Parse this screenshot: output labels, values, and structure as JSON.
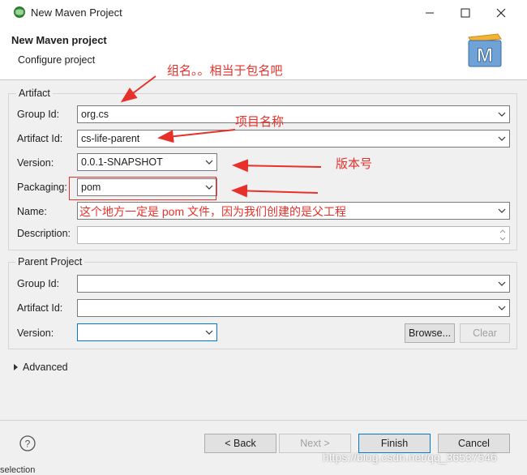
{
  "window": {
    "title": "New Maven Project"
  },
  "header": {
    "title": "New Maven project",
    "subtitle": "Configure project"
  },
  "artifact": {
    "legend": "Artifact",
    "group_id_label": "Group Id:",
    "group_id_value": "org.cs",
    "artifact_id_label": "Artifact Id:",
    "artifact_id_value": "cs-life-parent",
    "version_label": "Version:",
    "version_value": "0.0.1-SNAPSHOT",
    "packaging_label": "Packaging:",
    "packaging_value": "pom",
    "name_label": "Name:",
    "name_value": "",
    "description_label": "Description:",
    "description_value": ""
  },
  "parent": {
    "legend": "Parent Project",
    "group_id_label": "Group Id:",
    "group_id_value": "",
    "artifact_id_label": "Artifact Id:",
    "artifact_id_value": "",
    "version_label": "Version:",
    "version_value": "",
    "browse_label": "Browse...",
    "clear_label": "Clear"
  },
  "advanced": {
    "label": "Advanced"
  },
  "buttons": {
    "back": "< Back",
    "next": "Next >",
    "finish": "Finish",
    "cancel": "Cancel"
  },
  "annotations": {
    "group_note": "组名。。相当于包名吧",
    "artifact_note": "项目名称",
    "version_note": "版本号",
    "name_note": "这个地方一定是 pom 文件，因为我们创建的是父工程"
  },
  "watermark": "https://blog.csdn.net/qq_36537546",
  "bottom_cutoff": "selection",
  "colors": {
    "annotation": "#e8302a",
    "focus": "#0078d7"
  }
}
